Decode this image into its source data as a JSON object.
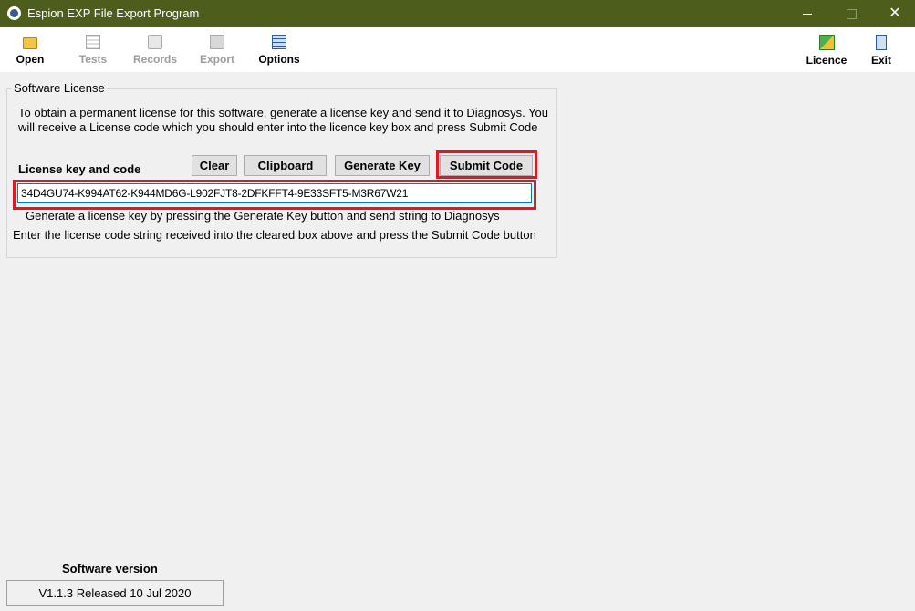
{
  "window": {
    "title": "Espion EXP File Export Program",
    "min_glyph": "",
    "close_glyph": "✕"
  },
  "toolbar": {
    "open": "Open",
    "tests": "Tests",
    "records": "Records",
    "export": "Export",
    "options": "Options",
    "licence": "Licence",
    "exit": "Exit"
  },
  "license": {
    "group_title": "Software License",
    "info": "To obtain a permanent license for this software, generate a license key and send it to Diagnosys. You will receive a License code which you should enter into the licence key box and press Submit Code",
    "key_label": "License key and code",
    "buttons": {
      "clear": "Clear",
      "clipboard": "Clipboard",
      "generate": "Generate Key",
      "submit": "Submit Code"
    },
    "key_value": "34D4GU74-K994AT62-K944MD6G-L902FJT8-2DFKFFT4-9E33SFT5-M3R67W21",
    "hint1": "Generate a license key  by pressing the Generate Key button  and send string to Diagnosys",
    "hint2": "Enter the license code string received into the cleared box above and press the Submit Code button"
  },
  "version": {
    "label": "Software version",
    "value": "V1.1.3 Released  10 Jul 2020"
  },
  "colors": {
    "titlebar": "#4d5e1c",
    "highlight": "#e8141e",
    "input_border": "#0078d7"
  }
}
